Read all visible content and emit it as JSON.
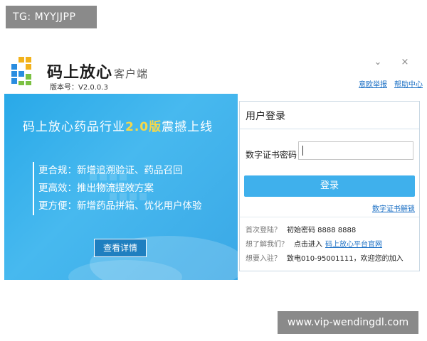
{
  "watermarks": {
    "top": "TG: MYYJJPP",
    "bottom": "www.vip-wendingdl.com"
  },
  "app": {
    "title": "码上放心",
    "subtitle": "客户端",
    "version": "版本号：V2.0.0.3",
    "icons": [
      "app-logo",
      "chevron-down-icon",
      "close-icon"
    ]
  },
  "top_links": {
    "report": "意欧举报",
    "help": "帮助中心"
  },
  "window_controls": {
    "dropdown": "⌄",
    "close": "×"
  },
  "banner": {
    "headline_prefix": "码上放心药品行业",
    "headline_highlight": "2.0版",
    "headline_suffix": "震撼上线",
    "features": [
      "更合规：新增追溯验证、药品召回",
      "更高效：推出物流提效方案",
      "更方便：新增药品拼箱、优化用户体验"
    ],
    "detail_button": "查看详情",
    "colors": {
      "background": "#3aaeea",
      "highlight": "#f5d84a"
    }
  },
  "login": {
    "title": "用户登录",
    "cert_label": "数字证书密码",
    "cert_value": "",
    "login_button": "登录",
    "unlock_link": "数字证书解锁",
    "info": [
      {
        "q": "首次登陆？",
        "a": "初始密码 8888 8888",
        "link": ""
      },
      {
        "q": "想了解我们？",
        "a": "点击进入",
        "link": "码上放心平台官网"
      },
      {
        "q": "想要入驻？",
        "a": "致电010-95001111，欢迎您的加入",
        "link": ""
      }
    ],
    "colors": {
      "button": "#3fb0ec",
      "link": "#1a6fc4"
    }
  }
}
